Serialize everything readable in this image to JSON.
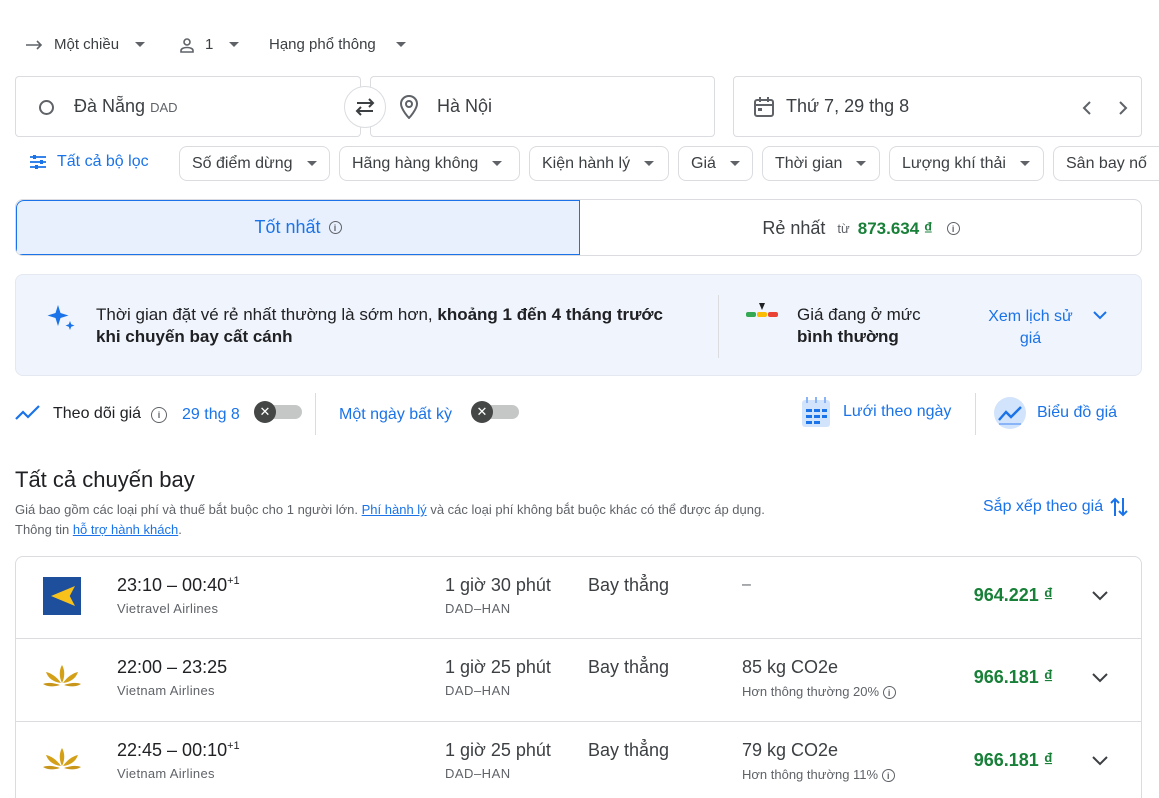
{
  "top": {
    "trip_type": "Một chiều",
    "passengers": "1",
    "cabin": "Hạng phổ thông"
  },
  "search": {
    "origin": "Đà Nẵng",
    "origin_code": "DAD",
    "destination": "Hà Nội",
    "date": "Thứ 7, 29 thg 8"
  },
  "filters": {
    "all": "Tất cả bộ lọc",
    "chips": [
      "Số điểm dừng",
      "Hãng hàng không",
      "Kiện hành lý",
      "Giá",
      "Thời gian",
      "Lượng khí thải",
      "Sân bay nố"
    ]
  },
  "sort_tabs": {
    "best": "Tốt nhất",
    "cheapest": "Rẻ nhất",
    "from": "từ",
    "cheapest_price": "873.634 ₫"
  },
  "insight": {
    "text_pre": "Thời gian đặt vé rẻ nhất thường là sớm hơn,",
    "text_bold": "khoảng 1 đến 4 tháng trước",
    "text_line2": "khi chuyến bay cất cánh",
    "price_level_line1": "Giá đang ở mức",
    "price_level_line2": "bình thường",
    "history_line1": "Xem lịch sử",
    "history_line2": "giá"
  },
  "tracking": {
    "label": "Theo dõi giá",
    "date": "29 thg 8",
    "any_date": "Một ngày bất kỳ",
    "toggle_mark": "✕",
    "date_grid": "Lưới theo ngày",
    "price_graph": "Biểu đồ giá"
  },
  "results": {
    "title": "Tất cả chuyến bay",
    "note_pre": "Giá bao gồm các loại phí và thuế bắt buộc cho 1 người lớn.",
    "note_link": "Phí hành lý",
    "note_post": "và các loại phí không bắt buộc khác có thể được áp dụng.",
    "note2_pre": "Thông tin",
    "note2_link": "hỗ trợ hành khách",
    "note2_post": ".",
    "sort_label": "Sắp xếp theo giá"
  },
  "flights": [
    {
      "times": "23:10 – 00:40",
      "plus": "+1",
      "airline": "Vietravel Airlines",
      "duration": "1 giờ 30 phút",
      "route": "DAD–HAN",
      "stops": "Bay thẳng",
      "co2": "–",
      "co2_note": "",
      "price": "964.221 ₫",
      "logo": "vietravel-logo"
    },
    {
      "times": "22:00 – 23:25",
      "plus": "",
      "airline": "Vietnam Airlines",
      "duration": "1 giờ 25 phút",
      "route": "DAD–HAN",
      "stops": "Bay thẳng",
      "co2": "85 kg CO2e",
      "co2_note": "Hơn thông thường 20%",
      "price": "966.181 ₫",
      "logo": "lotus-logo"
    },
    {
      "times": "22:45 – 00:10",
      "plus": "+1",
      "airline": "Vietnam Airlines",
      "duration": "1 giờ 25 phút",
      "route": "DAD–HAN",
      "stops": "Bay thẳng",
      "co2": "79 kg CO2e",
      "co2_note": "Hơn thông thường 11%",
      "price": "966.181 ₫",
      "logo": "lotus-logo"
    }
  ],
  "colors": {
    "accent": "#1a73e8",
    "price_green": "#188038",
    "selected_tab_bg": "#e8f0fe",
    "insight_bg": "#f0f4fc"
  }
}
